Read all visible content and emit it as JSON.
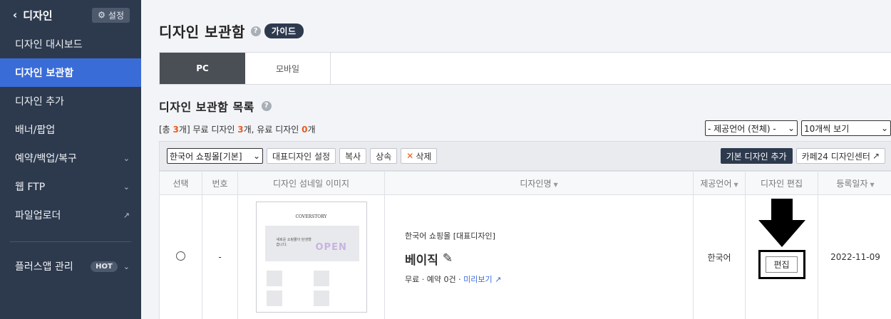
{
  "sidebar": {
    "title": "디자인",
    "settings_label": "설정",
    "items": [
      {
        "label": "디자인 대시보드"
      },
      {
        "label": "디자인 보관함"
      },
      {
        "label": "디자인 추가"
      },
      {
        "label": "배너/팝업"
      },
      {
        "label": "예약/백업/복구"
      },
      {
        "label": "웹 FTP"
      },
      {
        "label": "파일업로더"
      },
      {
        "label": "플러스앱 관리",
        "badge": "HOT"
      }
    ]
  },
  "header": {
    "title": "디자인 보관함",
    "help": "?",
    "guide": "가이드"
  },
  "tabs": [
    "PC",
    "모바일"
  ],
  "list": {
    "title": "디자인 보관함 목록",
    "summary": {
      "pre": "[총 ",
      "total": "3",
      "mid1": "개] 무료 디자인 ",
      "free": "3",
      "mid2": "개, 유료 디자인 ",
      "paid": "0",
      "post": "개"
    },
    "lang_select": "- 제공언어 (전체) -",
    "page_select": "10개씩 보기"
  },
  "toolbar": {
    "mall_select": "한국어 쇼핑몰[기본]",
    "set_default": "대표디자인 설정",
    "copy": "복사",
    "inherit": "상속",
    "delete": "삭제",
    "add_basic": "기본 디자인 추가",
    "cafe24_center": "카페24 디자인센터"
  },
  "table": {
    "headers": [
      "선택",
      "번호",
      "디자인 섬네일 이미지",
      "디자인명",
      "제공언어",
      "디자인 편집",
      "등록일자"
    ],
    "rows": [
      {
        "number": "-",
        "thumb_brand": "COVERSTORY",
        "thumb_text": "새로운 쇼핑몰이 탄생했습니다.",
        "thumb_open": "OPEN",
        "mall": "한국어 쇼핑몰 [대표디자인]",
        "name": "베이직",
        "price": "무료",
        "reservations": "예약 0건",
        "preview": "미리보기",
        "language": "한국어",
        "edit": "편집",
        "date": "2022-11-09"
      }
    ]
  }
}
